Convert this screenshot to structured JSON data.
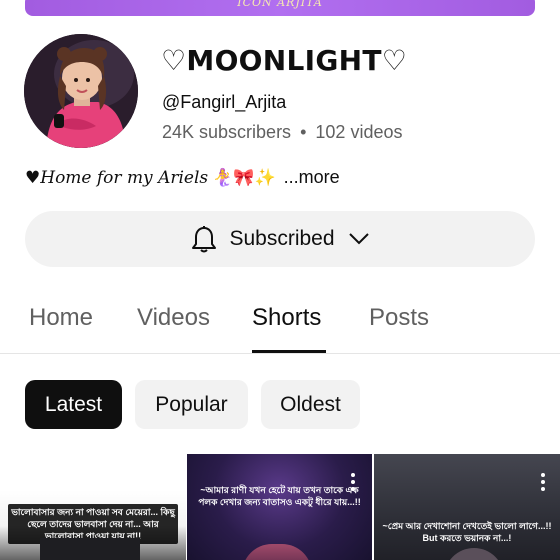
{
  "banner": {
    "text": "ICON ARJITA"
  },
  "channel": {
    "name": "♡MOONLIGHT♡",
    "handle": "@Fangirl_Arjita",
    "subscribers": "24K subscribers",
    "separator": "•",
    "videos": "102 videos"
  },
  "description": {
    "text": "♥Home for my Ariels",
    "emojis": "🧜‍♀️🎀✨",
    "more": "...more"
  },
  "subscribe": {
    "label": "Subscribed"
  },
  "tabs": [
    {
      "label": "Home"
    },
    {
      "label": "Videos"
    },
    {
      "label": "Shorts"
    },
    {
      "label": "Posts"
    }
  ],
  "chips": [
    {
      "label": "Latest"
    },
    {
      "label": "Popular"
    },
    {
      "label": "Oldest"
    }
  ],
  "shorts": [
    {
      "caption": "ভালোবাসার জন্য না পাওয়া সব মেয়েরা... কিছু ছেলে তাদের ভালবাসা দেয় না... আর ভালোবাসা পাওয়া যায় না!!"
    },
    {
      "caption": "~আমার রাণী যখন হেটে যায় তখন তাকে এক পলক দেখার জন্য বাতাসও একটু ধীরে যায়...!!"
    },
    {
      "caption": "~প্রেম আর দেখাশোনা দেখতেই ভালো লাগে...!! But করতে ভয়ানক না...!"
    }
  ],
  "colors": {
    "banner": "#a25ce0",
    "subscribe_bg": "#f2f2f2",
    "chip_active_bg": "#0f0f0f",
    "secondary_text": "#606060"
  }
}
